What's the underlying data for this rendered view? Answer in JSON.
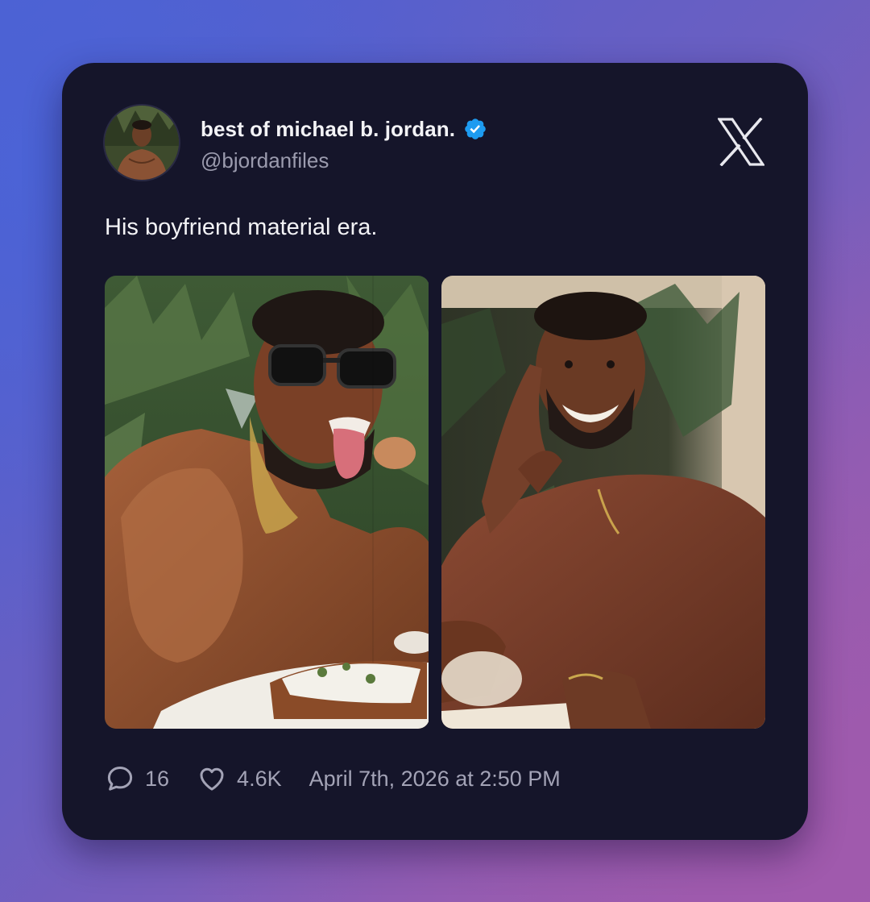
{
  "tweet": {
    "author": {
      "display_name": "best of michael b. jordan.",
      "handle": "@bjordanfiles",
      "verified": true,
      "avatar_icon": "profile-photo"
    },
    "platform_icon": "x-logo-icon",
    "text": "His boyfriend material era.",
    "media": [
      {
        "description_icon": "photo-sunglasses-tongue-out"
      },
      {
        "description_icon": "photo-smiling-brown-shirt"
      }
    ],
    "stats": {
      "replies": "16",
      "likes": "4.6K"
    },
    "timestamp": "April 7th, 2026 at 2:50 PM"
  },
  "colors": {
    "card_background": "#15152a",
    "verified_badge": "#1d9bf0",
    "primary_text": "#f3f3f6",
    "secondary_text": "#9b9bae"
  }
}
